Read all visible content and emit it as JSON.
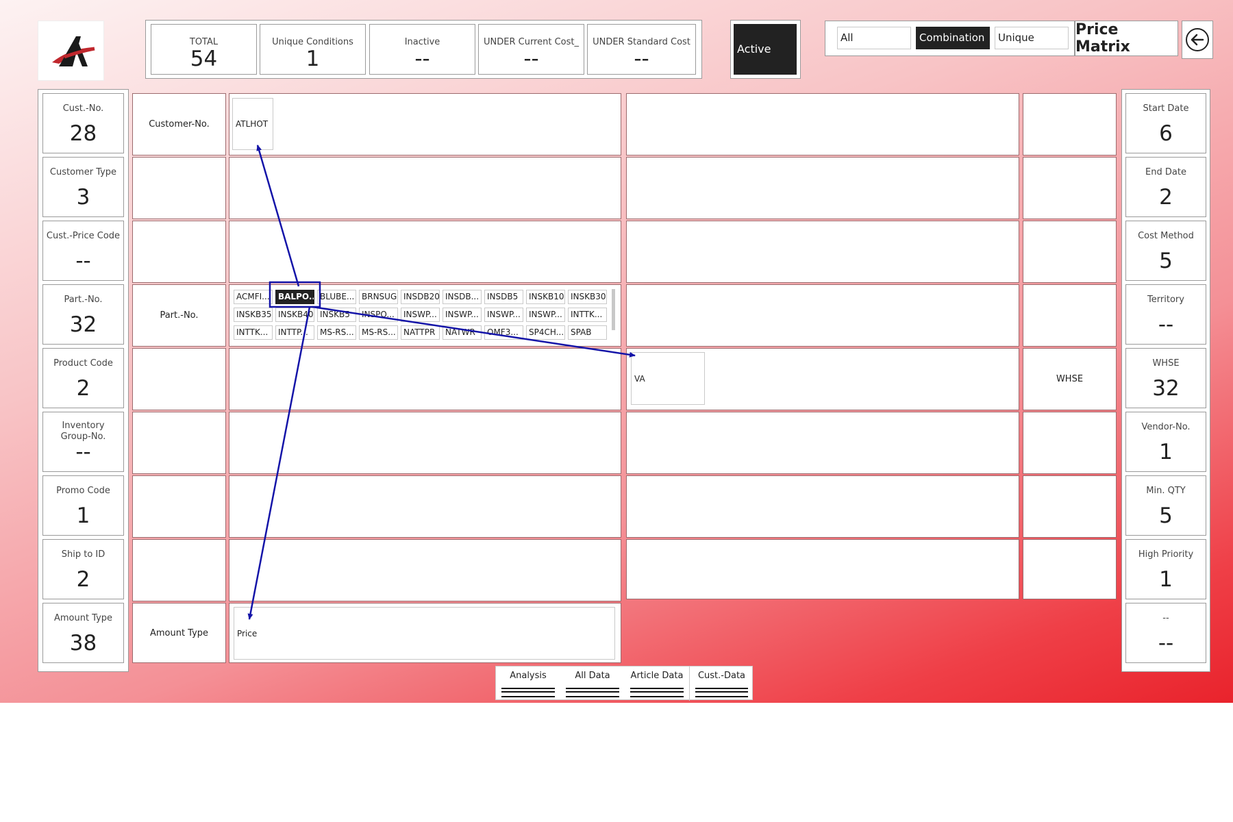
{
  "header": {
    "kpis": [
      {
        "label": "TOTAL",
        "value": "54"
      },
      {
        "label": "Unique Conditions",
        "value": "1"
      },
      {
        "label": "Inactive",
        "value": "--"
      },
      {
        "label": "UNDER Current Cost_",
        "value": "--"
      },
      {
        "label": "UNDER Standard Cost",
        "value": "--"
      }
    ],
    "active_label": "Active",
    "toggles": [
      "All",
      "Combination",
      "Unique"
    ],
    "selected_toggle": "Combination",
    "title": "Price Matrix",
    "back_icon": "back-arrow-icon"
  },
  "left_cards": [
    {
      "label": "Cust.-No.",
      "value": "28"
    },
    {
      "label": "Customer Type",
      "value": "3"
    },
    {
      "label": "Cust.-Price Code",
      "value": "--"
    },
    {
      "label": "Part.-No.",
      "value": "32"
    },
    {
      "label": "Product Code",
      "value": "2"
    },
    {
      "label": "Inventory Group-No.",
      "value": "--"
    },
    {
      "label": "Promo Code",
      "value": "1"
    },
    {
      "label": "Ship to ID",
      "value": "2"
    },
    {
      "label": "Amount Type",
      "value": "38"
    }
  ],
  "right_cards": [
    {
      "label": "Start Date",
      "value": "6"
    },
    {
      "label": "End Date",
      "value": "2"
    },
    {
      "label": "Cost Method",
      "value": "5"
    },
    {
      "label": "Territory",
      "value": "--"
    },
    {
      "label": "WHSE",
      "value": "32"
    },
    {
      "label": "Vendor-No.",
      "value": "1"
    },
    {
      "label": "Min. QTY",
      "value": "5"
    },
    {
      "label": "High Priority",
      "value": "1"
    },
    {
      "label": "--",
      "value": "--"
    }
  ],
  "row_labels": {
    "customer": "Customer-No.",
    "part": "Part.-No.",
    "amount": "Amount Type",
    "whse": "WHSE"
  },
  "values": {
    "customer": "ATLHOT",
    "whse": "VA",
    "amount": "Price"
  },
  "part_chips": [
    "ACMFI...",
    "BALPO...",
    "BLUBE...",
    "BRNSUG",
    "INSDB20",
    "INSDB...",
    "INSDB5",
    "INSKB10",
    "INSKB30",
    "INSKB35",
    "INSKB40",
    "INSKB5",
    "INSPO...",
    "INSWP...",
    "INSWP...",
    "INSWP...",
    "INSWP...",
    "INTTK...",
    "INTTK...",
    "INTTP...",
    "MS-RS...",
    "MS-RS...",
    "NATTPR",
    "NATWR",
    "OMF3...",
    "SP4CH...",
    "SPAB"
  ],
  "selected_chip": "BALPO...",
  "tabs": [
    "Analysis",
    "All Data",
    "Article Data",
    "Cust.-Data"
  ],
  "colors": {
    "arrow": "#1414a8",
    "selected": "#222222",
    "gradient_end": "#e9232c"
  }
}
